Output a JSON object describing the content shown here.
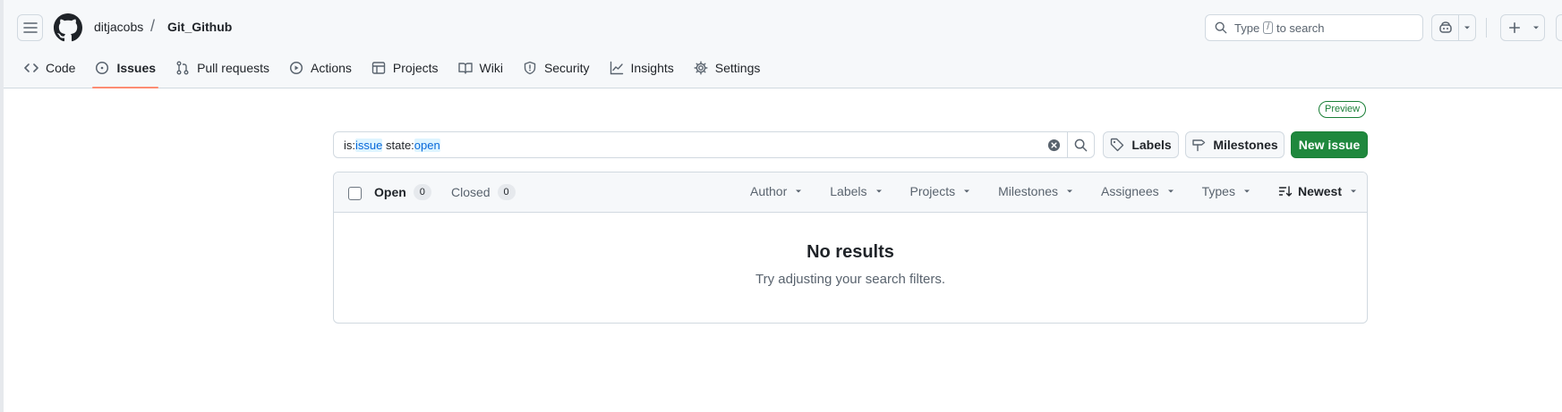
{
  "header": {
    "owner": "ditjacobs",
    "separator": "/",
    "repo": "Git_Github",
    "search": {
      "prefix": "Type",
      "key": "/",
      "suffix": "to search"
    }
  },
  "nav": {
    "tabs": [
      {
        "label": "Code",
        "icon": "code-icon"
      },
      {
        "label": "Issues",
        "icon": "issue-opened-icon",
        "active": true
      },
      {
        "label": "Pull requests",
        "icon": "git-pull-request-icon"
      },
      {
        "label": "Actions",
        "icon": "play-icon"
      },
      {
        "label": "Projects",
        "icon": "table-icon"
      },
      {
        "label": "Wiki",
        "icon": "book-icon"
      },
      {
        "label": "Security",
        "icon": "shield-icon"
      },
      {
        "label": "Insights",
        "icon": "graph-icon"
      },
      {
        "label": "Settings",
        "icon": "gear-icon"
      }
    ]
  },
  "issues": {
    "preview_label": "Preview",
    "query": {
      "k1": "is:",
      "v1": "issue",
      "space": " ",
      "k2": "state:",
      "v2": "open"
    },
    "labels_button": "Labels",
    "milestones_button": "Milestones",
    "new_issue_button": "New issue",
    "open_label": "Open",
    "open_count": "0",
    "closed_label": "Closed",
    "closed_count": "0",
    "filters": [
      "Author",
      "Labels",
      "Projects",
      "Milestones",
      "Assignees",
      "Types"
    ],
    "sort_label": "Newest",
    "empty_title": "No results",
    "empty_subtitle": "Try adjusting your search filters."
  },
  "colors": {
    "accent_green": "#1f883d",
    "active_tab_underline": "#fd8c73",
    "link_blue": "#0969da"
  }
}
